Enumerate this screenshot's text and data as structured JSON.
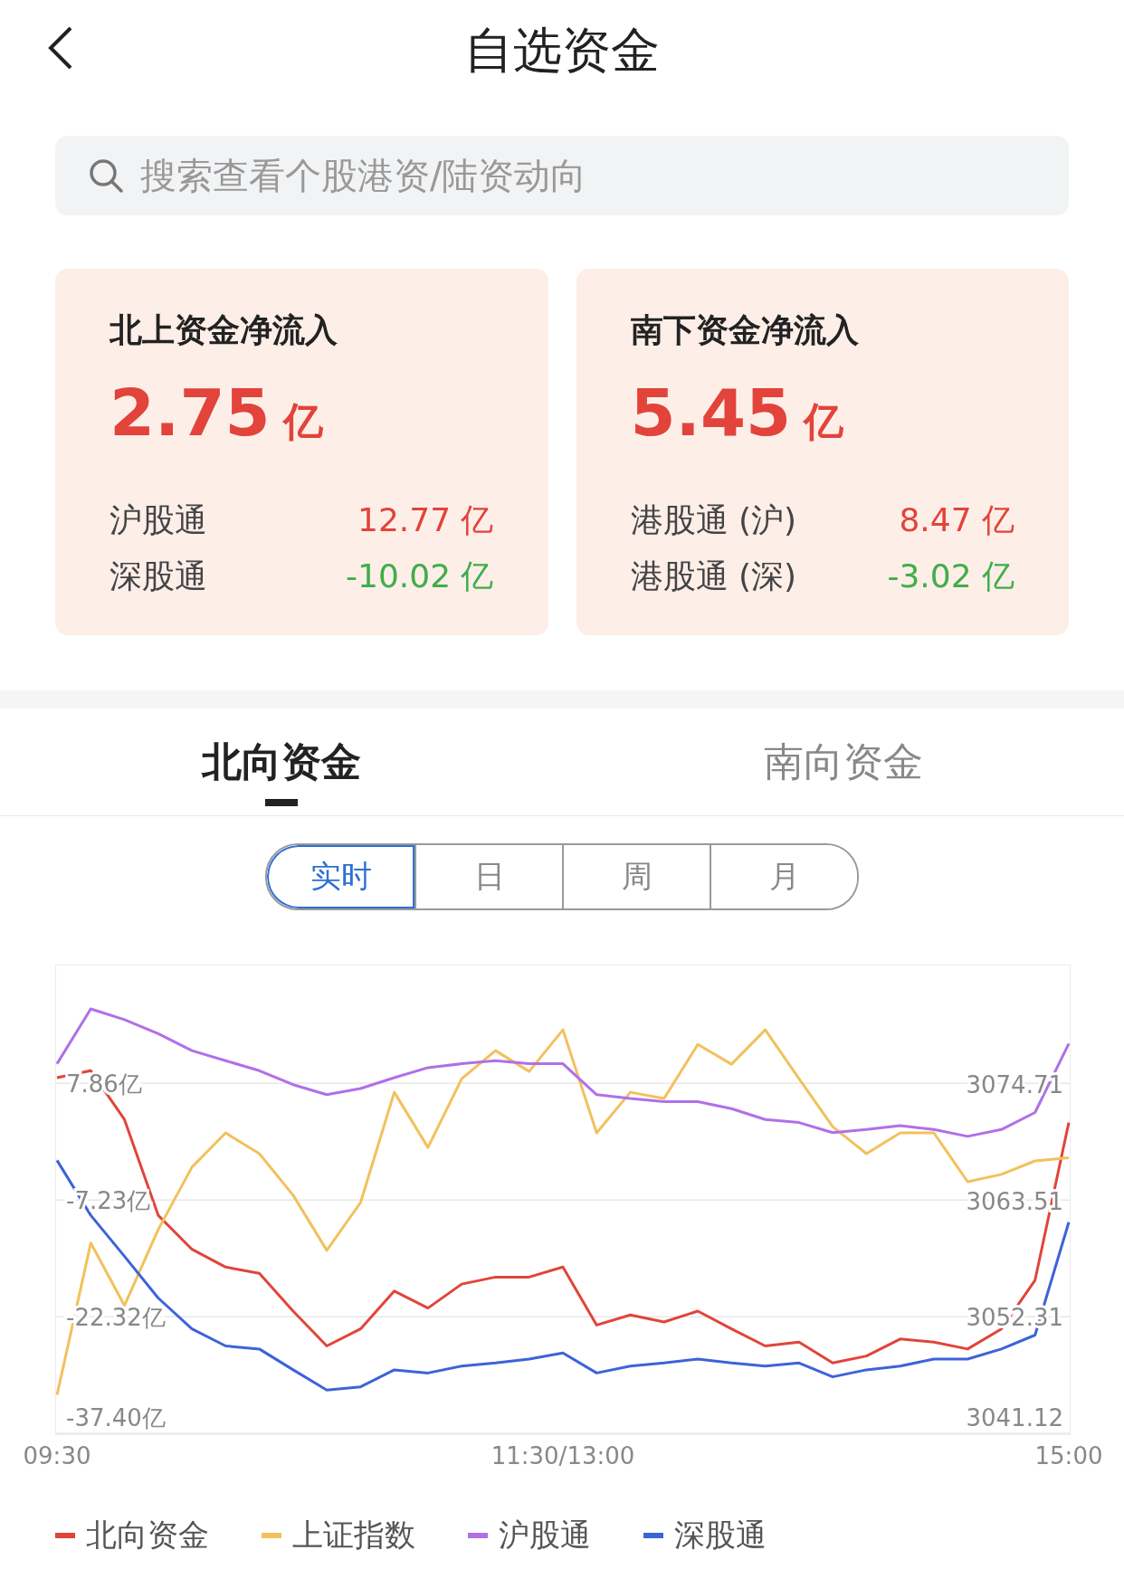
{
  "header": {
    "title": "自选资金"
  },
  "search": {
    "placeholder": "搜索查看个股港资/陆资动向"
  },
  "cards": [
    {
      "title": "北上资金净流入",
      "amount": "2.75",
      "unit": "亿",
      "rows": [
        {
          "label": "沪股通",
          "value": "12.77 亿",
          "color": "#e2433a"
        },
        {
          "label": "深股通",
          "value": "-10.02 亿",
          "color": "#3fae49"
        }
      ]
    },
    {
      "title": "南下资金净流入",
      "amount": "5.45",
      "unit": "亿",
      "rows": [
        {
          "label": "港股通 (沪)",
          "value": "8.47 亿",
          "color": "#e2433a"
        },
        {
          "label": "港股通 (深)",
          "value": "-3.02 亿",
          "color": "#3fae49"
        }
      ]
    }
  ],
  "tabs": [
    {
      "label": "北向资金",
      "selected": true
    },
    {
      "label": "南向资金",
      "selected": false
    }
  ],
  "periods": [
    {
      "label": "实时",
      "selected": true
    },
    {
      "label": "日",
      "selected": false
    },
    {
      "label": "周",
      "selected": false
    },
    {
      "label": "月",
      "selected": false
    }
  ],
  "chart_data": {
    "type": "line",
    "categories": [
      "09:30",
      null,
      null,
      null,
      null,
      null,
      null,
      null,
      null,
      null,
      null,
      null,
      null,
      null,
      null,
      "11:30/13:00",
      null,
      null,
      null,
      null,
      null,
      null,
      null,
      null,
      null,
      null,
      null,
      null,
      null,
      null,
      "15:00"
    ],
    "grid": true,
    "ylim": [
      -37.4,
      23
    ],
    "yticks": [
      {
        "value": 7.86,
        "label": "7.86亿"
      },
      {
        "value": -7.23,
        "label": "-7.23亿"
      },
      {
        "value": -22.32,
        "label": "-22.32亿"
      },
      {
        "value": -37.4,
        "label": "-37.40亿"
      }
    ],
    "y2lim": [
      3041.12,
      3086
    ],
    "y2ticks": [
      {
        "value": 3074.71,
        "label": "3074.71"
      },
      {
        "value": 3063.51,
        "label": "3063.51"
      },
      {
        "value": 3052.31,
        "label": "3052.31"
      },
      {
        "value": 3041.12,
        "label": "3041.12"
      }
    ],
    "series": [
      {
        "name": "北向资金",
        "color": "#e0453a",
        "values": [
          8.6,
          9.5,
          3.2,
          -9.2,
          -13.6,
          -15.9,
          -16.7,
          -21.6,
          -26.1,
          -23.9,
          -19,
          -21.2,
          -18.1,
          -17.2,
          -17.2,
          -15.9,
          -23.4,
          -22.1,
          -23,
          -21.6,
          -23.9,
          -26.1,
          -25.6,
          -28.3,
          -27.4,
          -25.2,
          -25.6,
          -26.5,
          -23.9,
          -17.6,
          2.8
        ]
      },
      {
        "name": "上证指数",
        "color": "#f2c15c",
        "axis": "y2",
        "values": [
          3044.8,
          3059.4,
          3053.4,
          3060.7,
          3066.7,
          3070,
          3068,
          3064,
          3058.7,
          3063.3,
          3073.9,
          3068.6,
          3075.2,
          3077.9,
          3075.9,
          3079.9,
          3070,
          3073.9,
          3073.3,
          3078.5,
          3076.6,
          3079.9,
          3075.2,
          3070.6,
          3068,
          3070,
          3070,
          3065.3,
          3066,
          3067.3,
          3067.6
        ]
      },
      {
        "name": "沪股通",
        "color": "#b070e8",
        "values": [
          10.4,
          17.5,
          16.1,
          14.3,
          12.1,
          10.8,
          9.5,
          7.7,
          6.4,
          7.2,
          8.6,
          9.9,
          10.4,
          10.8,
          10.4,
          10.4,
          6.4,
          5.9,
          5.5,
          5.5,
          4.6,
          3.2,
          2.8,
          1.5,
          1.9,
          2.4,
          1.9,
          1,
          1.9,
          4.1,
          13
        ]
      },
      {
        "name": "深股通",
        "color": "#3d63d9",
        "values": [
          -2.1,
          -9.2,
          -14.5,
          -19.9,
          -23.9,
          -26.1,
          -26.5,
          -29.2,
          -31.8,
          -31.4,
          -29.2,
          -29.6,
          -28.7,
          -28.3,
          -27.8,
          -27,
          -29.6,
          -28.7,
          -28.3,
          -27.8,
          -28.3,
          -28.7,
          -28.3,
          -30.1,
          -29.2,
          -28.7,
          -27.8,
          -27.8,
          -26.5,
          -24.7,
          -10.1
        ]
      }
    ]
  }
}
